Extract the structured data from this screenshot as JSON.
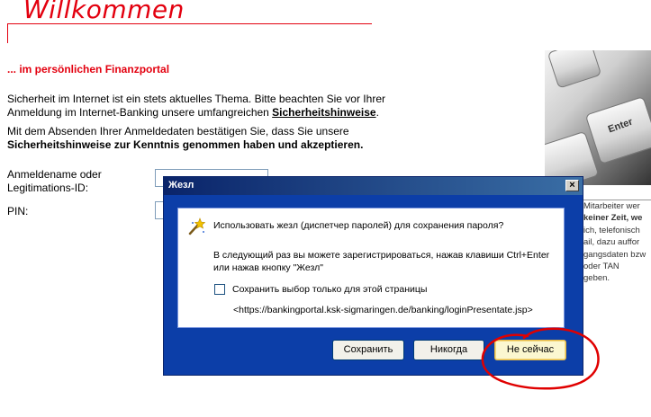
{
  "header": {
    "title": "Willkommen",
    "subtitle": "... im persönlichen Finanzportal"
  },
  "intro": {
    "p1_pre": "Sicherheit im Internet ist ein stets aktuelles Thema. Bitte beachten Sie vor Ihrer Anmeldung im Internet-Banking unsere umfangreichen ",
    "p1_link": "Sicherheitshinweise",
    "p1_post": ".",
    "p2_pre": "Mit dem Absenden Ihrer Anmeldedaten bestätigen Sie, dass Sie unsere ",
    "p2_bold": "Sicherheitshinweise zur Kenntnis genommen haben und akzeptieren."
  },
  "form": {
    "username_label": "Anmeldename oder Legitimations-ID:",
    "pin_label": "PIN:"
  },
  "right_panel": {
    "photo_key_label": "Enter",
    "lines": [
      "Mitarbeiter wer",
      "keiner Zeit, we",
      "ich, telefonisch",
      "ail, dazu auffor",
      "gangsdaten bzw",
      "oder TAN",
      "geben."
    ]
  },
  "dialog": {
    "title": "Жезл",
    "close_label": "×",
    "question": "Использовать жезл (диспетчер паролей) для сохранения пароля?",
    "info": "В следующий раз вы можете зарегистрироваться, нажав клавиши Ctrl+Enter или нажав кнопку \"Жезл\"",
    "checkbox_label": "Сохранить выбор только для этой страницы",
    "url": "<https://bankingportal.ksk-sigmaringen.de/banking/loginPresentate.jsp>",
    "buttons": {
      "save": "Сохранить",
      "never": "Никогда",
      "not_now": "Не сейчас"
    }
  },
  "colors": {
    "brand_red": "#e3000f",
    "dialog_blue": "#0c3ea8",
    "annotation_red": "#e00000"
  }
}
